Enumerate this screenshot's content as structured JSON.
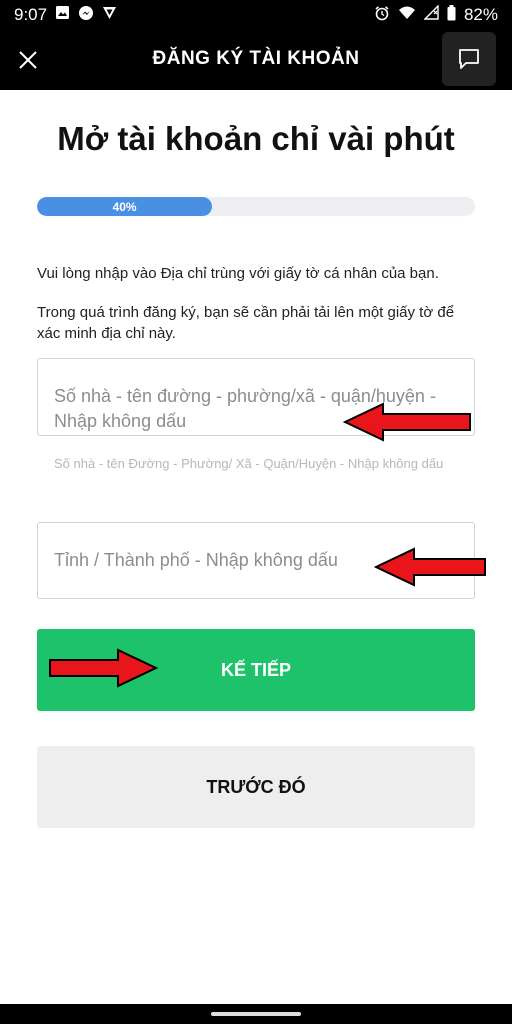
{
  "status": {
    "time": "9:07",
    "battery": "82%",
    "left_icons": [
      "image-icon",
      "messenger-icon",
      "vpn-icon"
    ],
    "right_icons": [
      "alarm-icon",
      "wifi-icon",
      "signal-icon",
      "battery-icon"
    ]
  },
  "app_bar": {
    "title": "ĐĂNG KÝ TÀI KHOẢN",
    "close_icon": "close-icon",
    "chat_icon": "chat-icon"
  },
  "heading": "Mở tài khoản chỉ vài phút",
  "progress": {
    "label": "40%",
    "value": 0.4,
    "color": "#4a90e2"
  },
  "info": {
    "line1": "Vui lòng nhập vào Địa chỉ trùng với giấy tờ cá nhân của bạn.",
    "line2": "Trong quá trình đăng ký, bạn sẽ cần phải tải lên một giấy tờ để xác minh địa chỉ này."
  },
  "address_field": {
    "placeholder": "Số nhà - tên đường - phường/xã - quận/huyện - Nhập không dấu",
    "helper": "Số nhà - tên Đường - Phường/ Xã - Quận/Huyện - Nhập không dấu"
  },
  "city_field": {
    "placeholder": "Tỉnh / Thành phố - Nhập không dấu"
  },
  "buttons": {
    "next": "KẾ TIẾP",
    "next_color": "#1ec26a",
    "prev": "TRƯỚC ĐÓ"
  },
  "annotations": {
    "arrow_color": "#e8161b"
  }
}
